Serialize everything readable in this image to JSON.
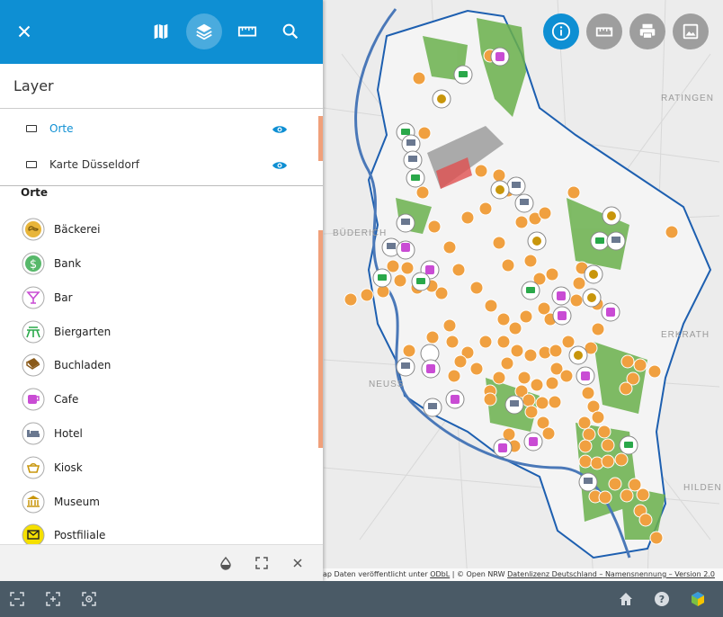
{
  "header": {
    "close_icon": "close-icon",
    "map_icon": "map-icon",
    "layers_icon": "layers-icon",
    "measure_icon": "ruler-icon",
    "search_icon": "search-icon"
  },
  "panel": {
    "title": "Layer",
    "layers": [
      {
        "label": "Orte",
        "active": true
      },
      {
        "label": "Karte Düsseldorf",
        "active": false
      }
    ],
    "legend_title": "Orte",
    "legend": [
      {
        "label": "Bäckerei",
        "icon": "bakery-icon"
      },
      {
        "label": "Bank",
        "icon": "bank-icon"
      },
      {
        "label": "Bar",
        "icon": "bar-icon"
      },
      {
        "label": "Biergarten",
        "icon": "beer-garden-icon"
      },
      {
        "label": "Buchladen",
        "icon": "bookstore-icon"
      },
      {
        "label": "Cafe",
        "icon": "cafe-icon"
      },
      {
        "label": "Hotel",
        "icon": "hotel-icon"
      },
      {
        "label": "Kiosk",
        "icon": "kiosk-icon"
      },
      {
        "label": "Museum",
        "icon": "museum-icon"
      },
      {
        "label": "Postfiliale",
        "icon": "post-office-icon"
      }
    ]
  },
  "map": {
    "labels": [
      "RATINGEN",
      "NEUSS",
      "HILDEN",
      "ERKRATH",
      "BÜDERICH"
    ],
    "attribution": {
      "prefix": "ap Daten veröffentlicht unter ",
      "odbl": "ODbL",
      "middle": " | © Open NRW ",
      "license": "Datenlizenz Deutschland – Namensnennung – Version 2.0"
    }
  },
  "colors": {
    "primary": "#0e8fd3",
    "map_button": "#9e9e9e",
    "bottom_bar": "#4a5a66",
    "cluster": "#f0a040",
    "green_area": "#6ab04c",
    "water": "#4a78b8"
  }
}
